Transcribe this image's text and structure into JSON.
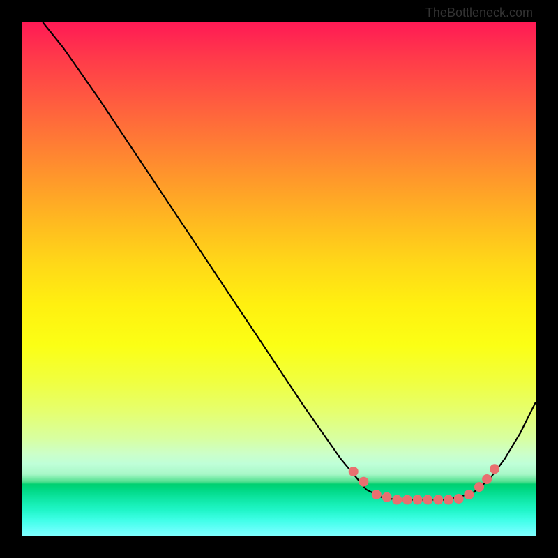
{
  "watermark": "TheBottleneck.com",
  "chart_data": {
    "type": "line",
    "title": "",
    "xlabel": "",
    "ylabel": "",
    "xlim": [
      0,
      100
    ],
    "ylim": [
      0,
      100
    ],
    "grid": false,
    "legend": false,
    "series": [
      {
        "name": "curve",
        "color": "#000000",
        "points": [
          {
            "x": 4,
            "y": 100
          },
          {
            "x": 8,
            "y": 95
          },
          {
            "x": 15,
            "y": 85
          },
          {
            "x": 25,
            "y": 70
          },
          {
            "x": 35,
            "y": 55
          },
          {
            "x": 45,
            "y": 40
          },
          {
            "x": 55,
            "y": 25
          },
          {
            "x": 62,
            "y": 15
          },
          {
            "x": 67,
            "y": 9
          },
          {
            "x": 70,
            "y": 7.5
          },
          {
            "x": 73,
            "y": 7
          },
          {
            "x": 76,
            "y": 7
          },
          {
            "x": 79,
            "y": 7
          },
          {
            "x": 82,
            "y": 7
          },
          {
            "x": 85,
            "y": 7.5
          },
          {
            "x": 88,
            "y": 8.5
          },
          {
            "x": 91,
            "y": 11
          },
          {
            "x": 94,
            "y": 15
          },
          {
            "x": 97,
            "y": 20
          },
          {
            "x": 100,
            "y": 26
          }
        ]
      }
    ],
    "markers": [
      {
        "x": 64.5,
        "y": 12.5
      },
      {
        "x": 66.5,
        "y": 10.5
      },
      {
        "x": 69,
        "y": 8
      },
      {
        "x": 71,
        "y": 7.5
      },
      {
        "x": 73,
        "y": 7
      },
      {
        "x": 75,
        "y": 7
      },
      {
        "x": 77,
        "y": 7
      },
      {
        "x": 79,
        "y": 7
      },
      {
        "x": 81,
        "y": 7
      },
      {
        "x": 83,
        "y": 7
      },
      {
        "x": 85,
        "y": 7.2
      },
      {
        "x": 87,
        "y": 8
      },
      {
        "x": 89,
        "y": 9.5
      },
      {
        "x": 90.5,
        "y": 11
      },
      {
        "x": 92,
        "y": 13
      }
    ],
    "marker_color": "#e87070",
    "marker_radius": 7
  }
}
